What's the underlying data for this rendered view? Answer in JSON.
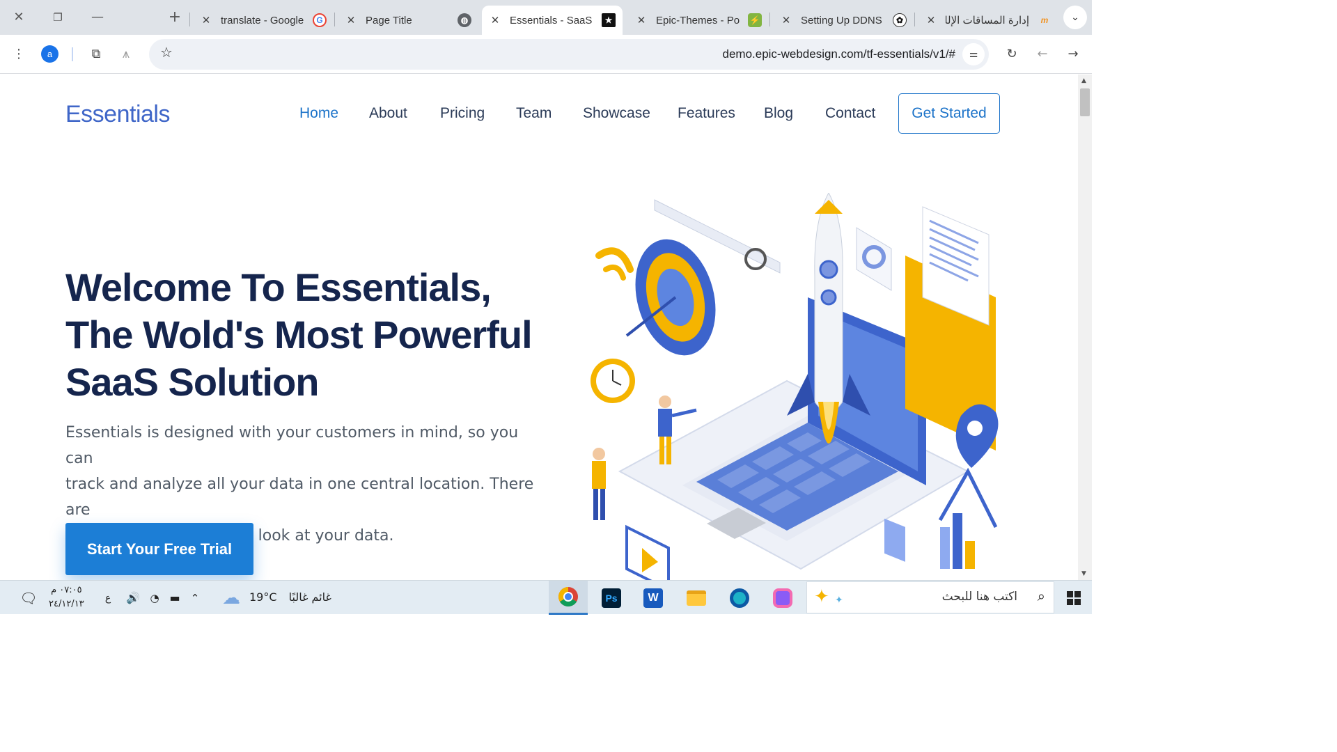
{
  "browser": {
    "tabs": [
      {
        "title": "translate - Google",
        "favicon": "google-icon"
      },
      {
        "title": "Page Title",
        "favicon": "globe-icon"
      },
      {
        "title": "Essentials - SaaS La",
        "favicon": "star-icon",
        "active": true
      },
      {
        "title": "Epic-Themes - Port",
        "favicon": "envato-icon"
      },
      {
        "title": "Setting Up DDNS",
        "favicon": "openai-icon"
      },
      {
        "title": "إدارة المساقات الإلك",
        "favicon": "moodle-icon"
      }
    ],
    "profile_initial": "a",
    "url": "demo.epic-webdesign.com/tf-essentials/v1/#"
  },
  "site": {
    "logo": "Essentials",
    "nav": [
      "Home",
      "About",
      "Pricing",
      "Team",
      "Showcase",
      "Features",
      "Blog",
      "Contact"
    ],
    "get_started": "Get Started",
    "hero": {
      "title_lines": [
        "Welcome To Essentials,",
        "The Wold's Most Powerful",
        "SaaS Solution"
      ],
      "description_lines": [
        "Essentials is designed with your customers in mind, so you can",
        "track and analyze all your data in one central location. There are",
        "no limits to how you can look at your data."
      ],
      "cta": "Start Your Free Trial"
    },
    "colors": {
      "brand": "#3f66c8",
      "nav_active": "#1c73c9",
      "heading": "#15254d",
      "cta": "#1c7ed6"
    }
  },
  "taskbar": {
    "time": "٠٧:٠٥ م",
    "date": "٢٤/١٢/١٣",
    "language": "ع",
    "temperature": "19°C",
    "weather": "غائم غالبًا",
    "search_placeholder": "اكتب هنا للبحث",
    "apps": [
      "chrome-icon",
      "photoshop-icon",
      "word-icon",
      "file-explorer-icon",
      "edge-icon",
      "copilot-icon"
    ]
  }
}
